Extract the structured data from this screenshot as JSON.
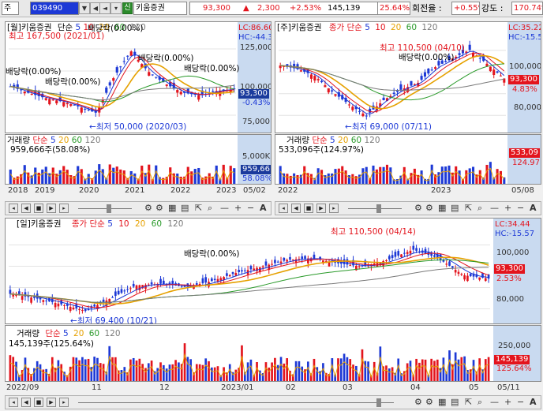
{
  "toolbar": {
    "menu_label": "주",
    "stock_code": "039490",
    "credit_badge": "신",
    "stock_name": "키움증권",
    "price": "93,300",
    "change_arrow": "▲",
    "change": "2,300",
    "change_pct": "+2.53%",
    "volume": "145,139",
    "volume_ratio": "25.64%",
    "turnover_label": "회전율 :",
    "turnover": "+0.55%",
    "strength_label": "강도 :",
    "strength": "170.74%"
  },
  "monthly": {
    "title": "[월]키움증권",
    "ma_label": "단순",
    "ma_periods": [
      "5",
      "10",
      "20",
      "60",
      "120"
    ],
    "lc": "LC:86.60",
    "hc": "HC:-44.3",
    "price_box": "93,300",
    "pct_box": "-0.43%",
    "y_ticks": [
      "125,000",
      "100,000",
      "75,000"
    ],
    "high_annotation": "최고 167,500 (2021/01)",
    "low_annotation": "최저 50,000 (2020/03)",
    "dividend_label": "배당락(0.00%)",
    "volume_title": "거래량",
    "volume_ma_label": "단순",
    "volume_value": "959,666주(58.08%)",
    "volume_y_tick": "5,000K",
    "volume_box": "959,66",
    "volume_pct_box": "58.08%",
    "x_labels": [
      "2018",
      "2019",
      "2020",
      "2021",
      "2022",
      "2023",
      "05/02"
    ]
  },
  "weekly": {
    "title": "[주]키움증권",
    "price_type": "종가",
    "ma_label": "단순",
    "ma_periods": [
      "5",
      "10",
      "20",
      "60",
      "120"
    ],
    "lc": "LC:35.22",
    "hc": "HC:-15.5",
    "price_box": "93,300",
    "pct_box": "4.83%",
    "y_ticks": [
      "100,000",
      "80,000"
    ],
    "high_annotation": "최고 110,500 (04/10)",
    "low_annotation": "최저 69,000 (07/11)",
    "dividend_label": "배당락(0.00%)",
    "volume_title": "거래량",
    "volume_ma_label": "단순",
    "volume_value": "533,096주(124.97%)",
    "volume_box": "533,09",
    "volume_pct_box": "124.97",
    "x_labels": [
      "2022",
      "2023",
      "05/08"
    ]
  },
  "daily": {
    "title": "[일]키움증권",
    "price_type": "종가",
    "ma_label": "단순",
    "ma_periods": [
      "5",
      "10",
      "20",
      "60",
      "120"
    ],
    "lc": "LC:34.44",
    "hc": "HC:-15.57",
    "price_box": "93,300",
    "pct_box": "2.53%",
    "y_ticks": [
      "100,000",
      "80,000"
    ],
    "high_annotation": "최고 110,500 (04/14)",
    "low_annotation": "최저 69,400 (10/21)",
    "dividend_label": "배당락(0.00%)",
    "volume_title": "거래량",
    "volume_ma_label": "단순",
    "volume_value": "145,139주(125.64%)",
    "volume_y_tick": "250,000",
    "volume_box": "145,139",
    "volume_pct_box": "125.64%",
    "x_labels": [
      "2022/09",
      "11",
      "12",
      "2023/01",
      "02",
      "03",
      "04",
      "05",
      "05/11"
    ]
  },
  "colors": {
    "up": "#e3141d",
    "down": "#1d39d6",
    "ma5": "#1d39d6",
    "ma10": "#e3141d",
    "ma20": "#e6a100",
    "ma60": "#2a9a2a",
    "ma120": "#7a7a7a",
    "axis_bg": "#c9daf0"
  }
}
